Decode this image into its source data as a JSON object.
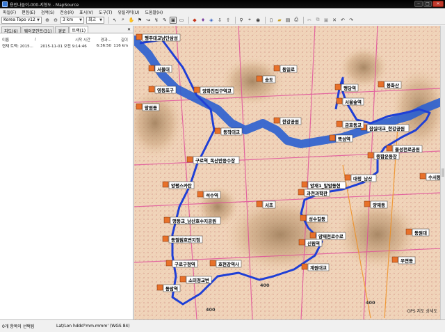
{
  "window": {
    "title": "용인나들이-000-지형도 - MapSource"
  },
  "menu": [
    "파일(F)",
    "편집(E)",
    "검색(S)",
    "전송(R)",
    "표시(V)",
    "도구(T)",
    "유틸리티(U)",
    "도움말(H)"
  ],
  "toolbar": {
    "map_product": "Korea Topo v12",
    "scale": "3 km",
    "detail": "최고"
  },
  "left_pane": {
    "tabs": [
      "지도(6)",
      "웨이포인트(31)",
      "경로",
      "트랙(1)"
    ],
    "active_tab": "트랙(1)",
    "columns": [
      "이름",
      "/",
      "시작 시간",
      "경과...",
      "길이"
    ],
    "rows": [
      {
        "name": "현재 트랙: 2015...",
        "start": "2015-11-01 오전 9:14:46",
        "elapsed": "6:36:50",
        "length": "116 km"
      }
    ]
  },
  "map": {
    "labels": [
      "행주대교남단삼성",
      "양화진입구역교",
      "영등포구",
      "구로역_독산반응수장",
      "석수역",
      "양평스카탄",
      "명동교_남산호수지공원",
      "동절림호변지점",
      "구로구청역",
      "소미정교변",
      "동암역",
      "호현강역사",
      "행당역",
      "서울숲역",
      "잠실대교_한강공원",
      "금호동교",
      "율성천로공원",
      "뚝섬역",
      "종합운동장",
      "봉화산",
      "과천과학관",
      "대청_남산",
      "양재1_말암동현",
      "동작대교",
      "송도",
      "성수길동",
      "양재천로수로",
      "신림역",
      "계원대교",
      "동일로",
      "서울대",
      "망원동",
      "수서동",
      "동원대",
      "우면동",
      "한강공원",
      "서초",
      "양재동",
      "400",
      "400",
      "400"
    ],
    "right_edge_text": "GPS 지도 상세도"
  },
  "status": {
    "selection": "0개 항목이 선택됨",
    "coordinate_format": "Lat/Lon hddd°mm.mmm' (WGS 84)"
  },
  "colors": {
    "titlebar": "#000000",
    "route": "#1f3fd6",
    "river": "#2a5fd0",
    "terrain": "#f2d3b0"
  }
}
